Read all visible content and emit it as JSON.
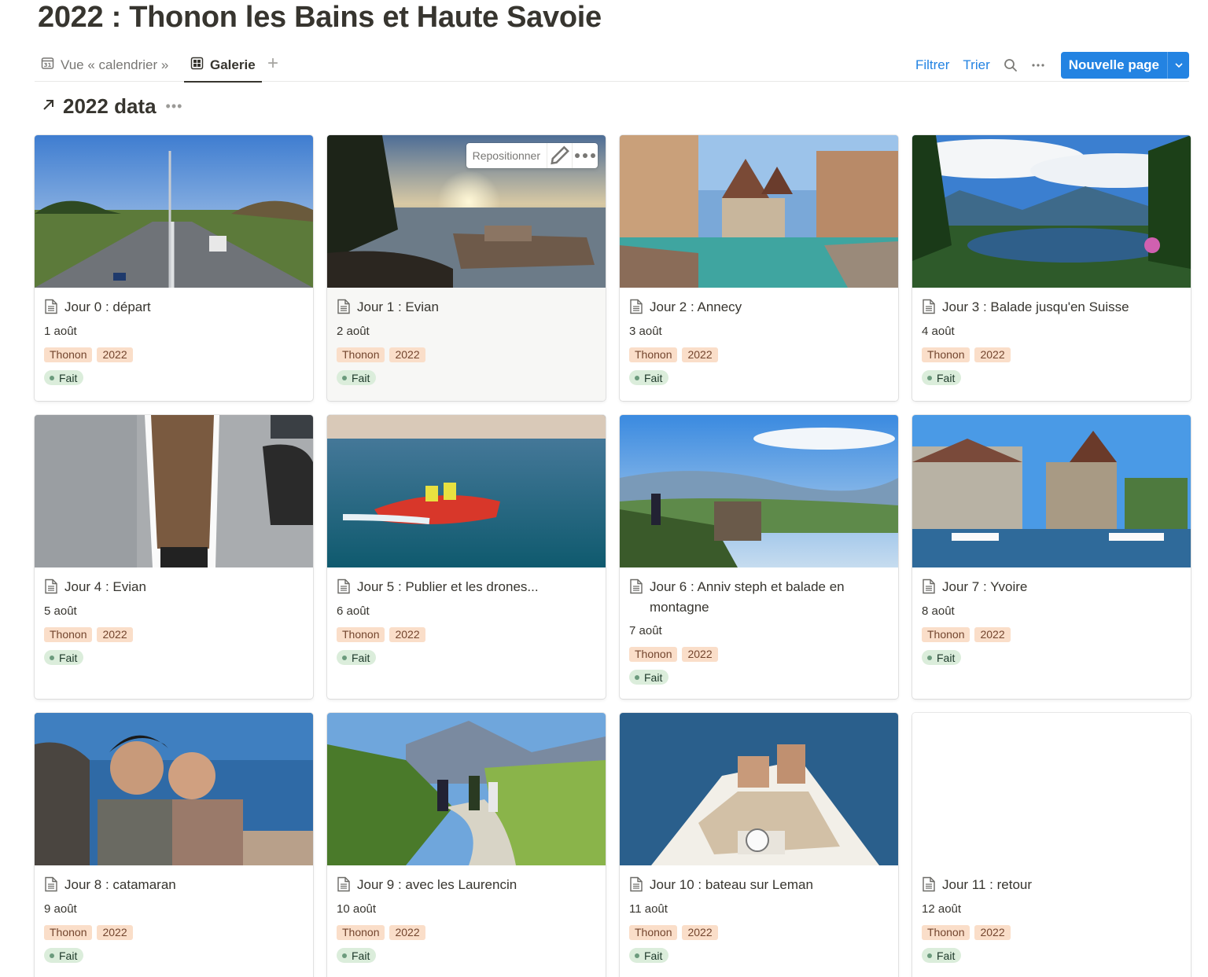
{
  "page": {
    "title": "2022 : Thonon les Bains et Haute Savoie"
  },
  "views": {
    "tabs": [
      {
        "label": "Vue « calendrier »",
        "icon": "calendar-icon",
        "active": false
      },
      {
        "label": "Galerie",
        "icon": "gallery-grid-icon",
        "active": true
      }
    ],
    "add_icon": "plus-icon"
  },
  "toolbar": {
    "filter_label": "Filtrer",
    "sort_label": "Trier",
    "search_icon": "search-icon",
    "more_icon": "more-horizontal-icon",
    "new_page_label": "Nouvelle page",
    "new_page_arrow_icon": "chevron-down-icon"
  },
  "database": {
    "title": "2022 data",
    "link_icon": "arrow-up-right-icon",
    "more_icon": "more-horizontal-icon"
  },
  "cover_menu": {
    "label": "Repositionner",
    "edit_icon": "pencil-icon",
    "more_icon": "more-horizontal-icon"
  },
  "colors": {
    "accent": "#2383e2",
    "tag_bg": "#fadec9",
    "tag_text": "#73452e",
    "status_bg": "#dbeddb",
    "status_dot": "#6c9b7d"
  },
  "cards": [
    {
      "title": "Jour 0 : départ",
      "date": "1 août",
      "tags": [
        "Thonon",
        "2022"
      ],
      "status": "Fait",
      "cover": "highway"
    },
    {
      "title": "Jour 1 : Evian",
      "date": "2 août",
      "tags": [
        "Thonon",
        "2022"
      ],
      "status": "Fait",
      "cover": "lake-sunset"
    },
    {
      "title": "Jour 2 : Annecy",
      "date": "3 août",
      "tags": [
        "Thonon",
        "2022"
      ],
      "status": "Fait",
      "cover": "canal-castle"
    },
    {
      "title": "Jour 3 : Balade jusqu'en Suisse",
      "date": "4 août",
      "tags": [
        "Thonon",
        "2022"
      ],
      "status": "Fait",
      "cover": "mountain-lake"
    },
    {
      "title": "Jour 4 : Evian",
      "date": "5 août",
      "tags": [
        "Thonon",
        "2022"
      ],
      "status": "Fait",
      "cover": "skateboard"
    },
    {
      "title": "Jour 5 : Publier et les drones...",
      "date": "6 août",
      "tags": [
        "Thonon",
        "2022"
      ],
      "status": "Fait",
      "cover": "rescue-boat"
    },
    {
      "title": "Jour 6 : Anniv steph et balade en montagne",
      "date": "7 août",
      "tags": [
        "Thonon",
        "2022"
      ],
      "status": "Fait",
      "cover": "viewpoint"
    },
    {
      "title": "Jour 7 : Yvoire",
      "date": "8 août",
      "tags": [
        "Thonon",
        "2022"
      ],
      "status": "Fait",
      "cover": "village-harbour"
    },
    {
      "title": "Jour 8 : catamaran",
      "date": "9 août",
      "tags": [
        "Thonon",
        "2022"
      ],
      "status": "Fait",
      "cover": "selfie"
    },
    {
      "title": "Jour 9 : avec les Laurencin",
      "date": "10 août",
      "tags": [
        "Thonon",
        "2022"
      ],
      "status": "Fait",
      "cover": "hiking-path"
    },
    {
      "title": "Jour 10 : bateau sur Leman",
      "date": "11 août",
      "tags": [
        "Thonon",
        "2022"
      ],
      "status": "Fait",
      "cover": "motorboat"
    },
    {
      "title": "Jour 11 : retour",
      "date": "12 août",
      "tags": [
        "Thonon",
        "2022"
      ],
      "status": "Fait",
      "cover": ""
    }
  ]
}
